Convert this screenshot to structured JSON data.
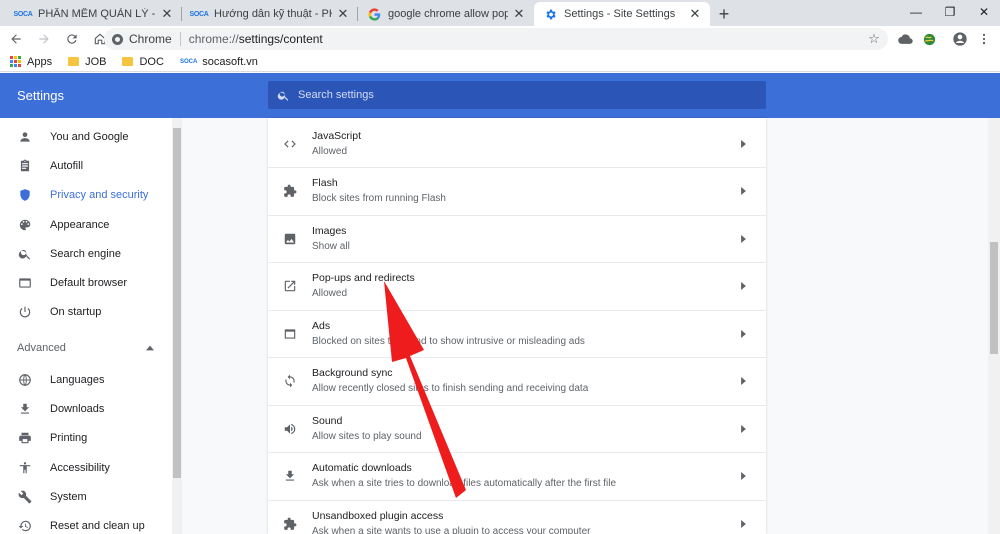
{
  "tabs": [
    {
      "title": "PHẦN MỀM QUẢN LÝ - SOCASOFT",
      "favicon": "soca",
      "active": false
    },
    {
      "title": "Hướng dẫn kỹ thuật - PHẦN MỀM",
      "favicon": "soca",
      "active": false
    },
    {
      "title": "google chrome allow pop ups - Google",
      "favicon": "google",
      "active": false
    },
    {
      "title": "Settings - Site Settings",
      "favicon": "gear",
      "active": true
    }
  ],
  "soca_logo": "SOCA",
  "tab_close_glyph": "✕",
  "new_tab_glyph": "+",
  "window_controls": {
    "minimize": "—",
    "restore": "❐",
    "close": "✕"
  },
  "toolbar": {
    "site_chip": "Chrome",
    "url_scheme": "chrome://",
    "url_path": "settings/content"
  },
  "bookmarks": [
    {
      "label": "Apps",
      "icon": "apps-grid"
    },
    {
      "label": "JOB",
      "icon": "folder"
    },
    {
      "label": "DOC",
      "icon": "folder"
    },
    {
      "label": "socasoft.vn",
      "icon": "soca"
    }
  ],
  "settings": {
    "title": "Settings",
    "search_placeholder": "Search settings"
  },
  "sidebar": {
    "items": [
      {
        "label": "You and Google",
        "icon": "person-icon",
        "active": false
      },
      {
        "label": "Autofill",
        "icon": "clipboard-icon",
        "active": false
      },
      {
        "label": "Privacy and security",
        "icon": "shield-icon",
        "active": true
      },
      {
        "label": "Appearance",
        "icon": "palette-icon",
        "active": false
      },
      {
        "label": "Search engine",
        "icon": "search-icon",
        "active": false
      },
      {
        "label": "Default browser",
        "icon": "browser-icon",
        "active": false
      },
      {
        "label": "On startup",
        "icon": "power-icon",
        "active": false
      }
    ],
    "advanced_label": "Advanced",
    "advanced_items": [
      {
        "label": "Languages",
        "icon": "globe-icon"
      },
      {
        "label": "Downloads",
        "icon": "download-icon"
      },
      {
        "label": "Printing",
        "icon": "printer-icon"
      },
      {
        "label": "Accessibility",
        "icon": "accessibility-icon"
      },
      {
        "label": "System",
        "icon": "wrench-icon"
      },
      {
        "label": "Reset and clean up",
        "icon": "reset-icon"
      }
    ]
  },
  "content_rows": [
    {
      "title": "JavaScript",
      "subtitle": "Allowed",
      "icon": "code-icon"
    },
    {
      "title": "Flash",
      "subtitle": "Block sites from running Flash",
      "icon": "puzzle-icon"
    },
    {
      "title": "Images",
      "subtitle": "Show all",
      "icon": "image-icon"
    },
    {
      "title": "Pop-ups and redirects",
      "subtitle": "Allowed",
      "icon": "open-external-icon"
    },
    {
      "title": "Ads",
      "subtitle": "Blocked on sites that tend to show intrusive or misleading ads",
      "icon": "ads-window-icon"
    },
    {
      "title": "Background sync",
      "subtitle": "Allow recently closed sites to finish sending and receiving data",
      "icon": "sync-icon"
    },
    {
      "title": "Sound",
      "subtitle": "Allow sites to play sound",
      "icon": "speaker-icon"
    },
    {
      "title": "Automatic downloads",
      "subtitle": "Ask when a site tries to download files automatically after the first file",
      "icon": "download-icon"
    },
    {
      "title": "Unsandboxed plugin access",
      "subtitle": "Ask when a site wants to use a plugin to access your computer",
      "icon": "puzzle-icon"
    }
  ],
  "colors": {
    "header_blue": "#3d6fd8",
    "active_blue": "#3d6fd8",
    "annotation_red": "#ee1c1c"
  }
}
